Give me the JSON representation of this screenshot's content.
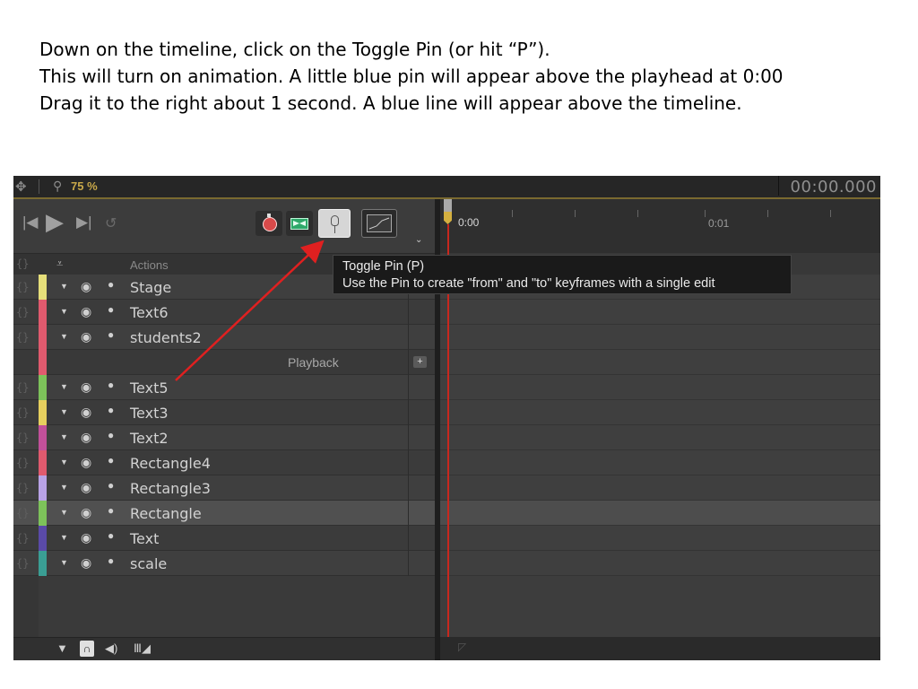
{
  "instructions": {
    "line1": "Down on the timeline, click on the Toggle Pin (or hit “P”).",
    "line2": "This will turn on animation. A little blue pin will appear above the playhead at 0:00",
    "line3": "Drag it to the right about 1 second.   A blue line will appear above the timeline."
  },
  "topbar": {
    "zoom": "75 %",
    "time": "00:00.000"
  },
  "timeline_header": {
    "actions_label": "Actions"
  },
  "ruler": {
    "t0": "0:00",
    "t1": "0:01"
  },
  "layers": [
    {
      "name": "Stage",
      "color": "#e6df7a"
    },
    {
      "name": "Text6",
      "color": "#e05a6e"
    },
    {
      "name": "students2",
      "color": "#e05a6e"
    },
    {
      "name": "Text5",
      "color": "#7dc25a"
    },
    {
      "name": "Text3",
      "color": "#e6cf5e"
    },
    {
      "name": "Text2",
      "color": "#c2509a"
    },
    {
      "name": "Rectangle4",
      "color": "#e05a6e"
    },
    {
      "name": "Rectangle3",
      "color": "#b9a3e6"
    },
    {
      "name": "Rectangle",
      "color": "#7dc25a"
    },
    {
      "name": "Text",
      "color": "#5a4aa8"
    },
    {
      "name": "scale",
      "color": "#3a9e94"
    }
  ],
  "playback_label": "Playback",
  "tooltip": {
    "title": "Toggle Pin (P)",
    "body": "Use the Pin to create \"from\" and \"to\" keyframes with a single edit"
  },
  "icons": {
    "move": "move-icon",
    "zoom": "magnifier-icon",
    "skip_start": "skip-to-start-icon",
    "play": "play-icon",
    "skip_end": "skip-to-end-icon",
    "loop": "loop-icon",
    "stopwatch": "stopwatch-icon",
    "envelope": "auto-keyframe-icon",
    "pin": "pin-icon",
    "graph": "easing-graph-icon",
    "filter": "filter-icon",
    "magnet": "magnet-icon",
    "audio": "audio-icon",
    "grid": "grid-icon"
  }
}
